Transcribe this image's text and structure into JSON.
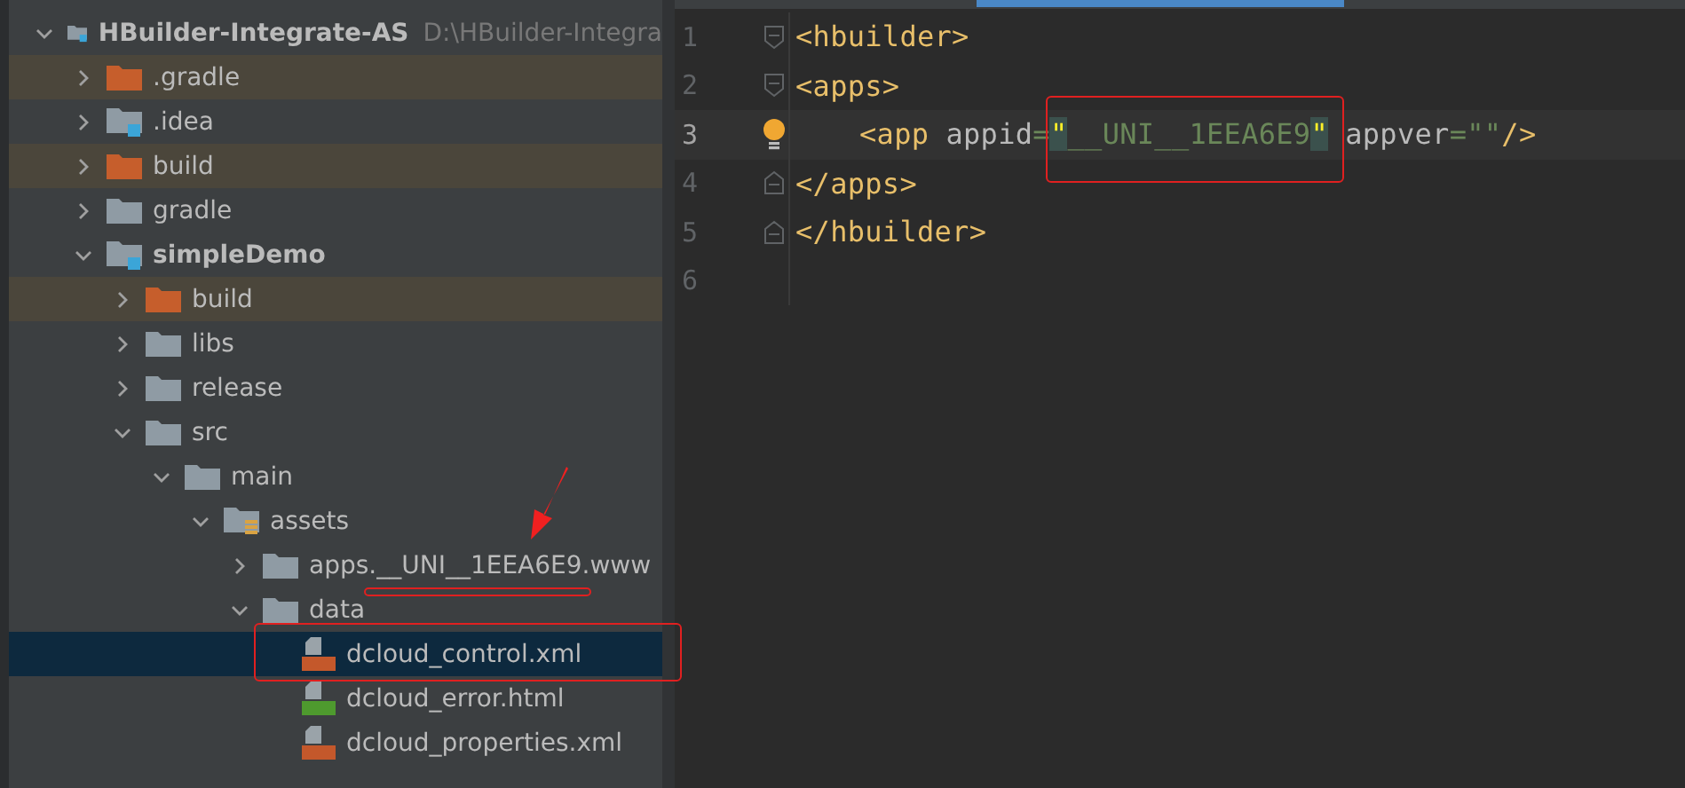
{
  "project_tree": {
    "label": "HBuilder-Integrate-AS",
    "path": "D:\\HBuilder-Integra",
    "kind": "module",
    "expanded": true,
    "selected": false,
    "children": [
      {
        "label": ".gradle",
        "kind": "excluded",
        "expanded": false,
        "selected": false
      },
      {
        "label": ".idea",
        "kind": "module",
        "expanded": false,
        "selected": false,
        "bold": false
      },
      {
        "label": "build",
        "kind": "excluded",
        "expanded": false,
        "selected": false
      },
      {
        "label": "gradle",
        "kind": "folder",
        "expanded": false,
        "selected": false
      },
      {
        "label": "simpleDemo",
        "kind": "module",
        "expanded": true,
        "selected": false,
        "children": [
          {
            "label": "build",
            "kind": "excluded",
            "expanded": false,
            "selected": false
          },
          {
            "label": "libs",
            "kind": "folder",
            "expanded": false,
            "selected": false
          },
          {
            "label": "release",
            "kind": "folder",
            "expanded": false,
            "selected": false
          },
          {
            "label": "src",
            "kind": "folder",
            "expanded": true,
            "selected": false,
            "children": [
              {
                "label": "main",
                "kind": "folder",
                "expanded": true,
                "selected": false,
                "children": [
                  {
                    "label": "assets",
                    "kind": "resources",
                    "expanded": true,
                    "selected": false,
                    "children": [
                      {
                        "label": "apps.__UNI__1EEA6E9.www",
                        "kind": "folder",
                        "expanded": false,
                        "selected": false
                      },
                      {
                        "label": "data",
                        "kind": "folder",
                        "expanded": true,
                        "selected": false,
                        "children": [
                          {
                            "label": "dcloud_control.xml",
                            "kind": "xml",
                            "selected": true
                          },
                          {
                            "label": "dcloud_error.html",
                            "kind": "html",
                            "selected": false
                          },
                          {
                            "label": "dcloud_properties.xml",
                            "kind": "xml",
                            "selected": false
                          }
                        ]
                      }
                    ]
                  }
                ]
              }
            ]
          }
        ]
      }
    ]
  },
  "editor": {
    "lines": [
      {
        "number": "1",
        "kind": "fold-start",
        "current": false,
        "tokens": [
          {
            "text": "<hbuilder>",
            "kind": "tag"
          }
        ]
      },
      {
        "number": "2",
        "kind": "fold-start",
        "current": false,
        "tokens": [
          {
            "text": "<apps>",
            "kind": "tag"
          }
        ]
      },
      {
        "number": "3",
        "kind": "bulb",
        "current": true,
        "tokens": [
          {
            "text": "<app",
            "kind": "tag"
          },
          {
            "text": "appid",
            "kind": "attr"
          },
          {
            "text": "=",
            "kind": "value"
          },
          {
            "text": "\"",
            "kind": "quote"
          },
          {
            "text": "__UNI__1EEA6E9",
            "kind": "value"
          },
          {
            "text": "\"",
            "kind": "quote"
          },
          {
            "text": "appver",
            "kind": "attr"
          },
          {
            "text": "=\"\"",
            "kind": "value"
          },
          {
            "text": "/>",
            "kind": "tag"
          }
        ]
      },
      {
        "number": "4",
        "kind": "fold-end",
        "current": false,
        "tokens": [
          {
            "text": "</apps>",
            "kind": "tag"
          }
        ]
      },
      {
        "number": "5",
        "kind": "fold-end",
        "current": false,
        "tokens": [
          {
            "text": "</hbuilder>",
            "kind": "tag"
          }
        ]
      },
      {
        "number": "6",
        "kind": "plain",
        "current": false
      }
    ]
  }
}
